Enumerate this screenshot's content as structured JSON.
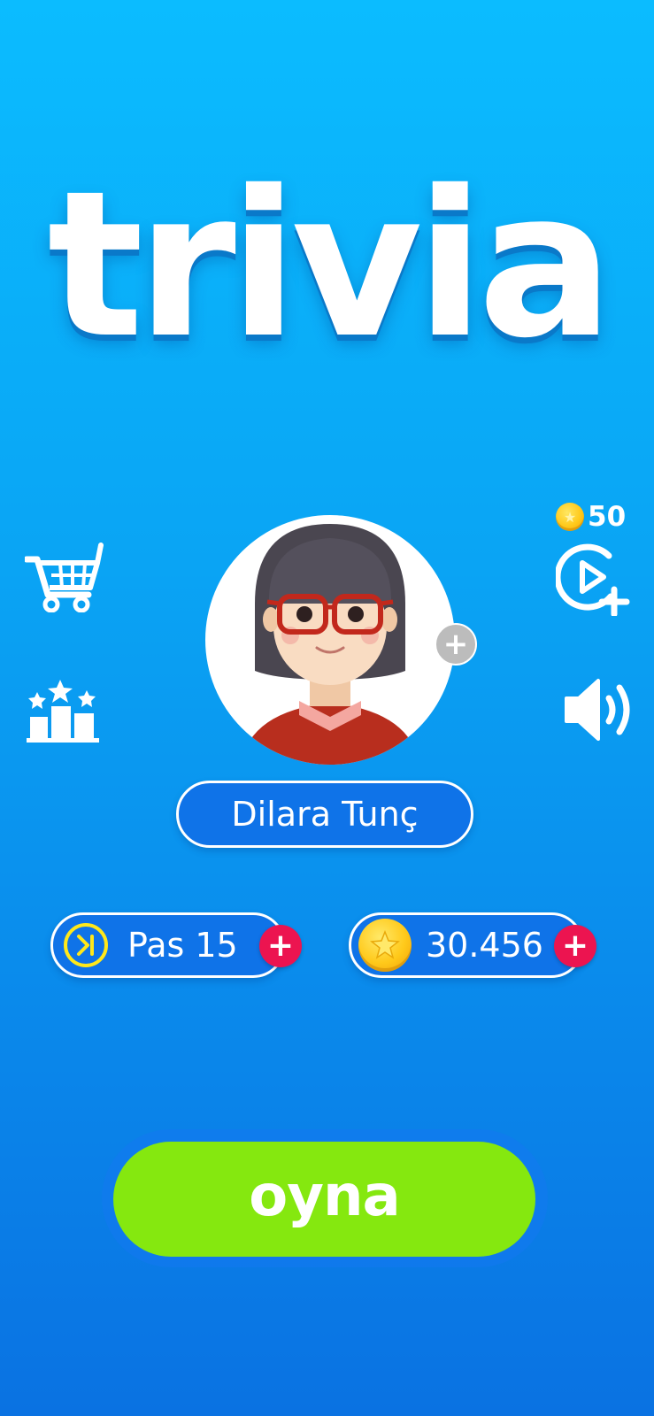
{
  "app": {
    "logo_text": "trivia"
  },
  "reward": {
    "coin_amount": "50",
    "icon": "video-plus-icon"
  },
  "profile": {
    "name": "Dilara Tunç",
    "avatar": "avatar-girl-glasses",
    "add_icon": "plus-icon"
  },
  "stats": {
    "pass_label": "Pas 15",
    "coins_label": "30.456"
  },
  "actions": {
    "play_label": "oyna"
  },
  "icons": {
    "cart": "shopping-cart-icon",
    "leaderboard": "leaderboard-icon",
    "sound": "speaker-icon"
  },
  "colors": {
    "background_top": "#0bbcff",
    "background_bottom": "#0a72e2",
    "play_button": "#85e80f",
    "plus_button": "#ec1450",
    "coin": "#ffc91a",
    "pass_ring": "#ffe81a"
  }
}
